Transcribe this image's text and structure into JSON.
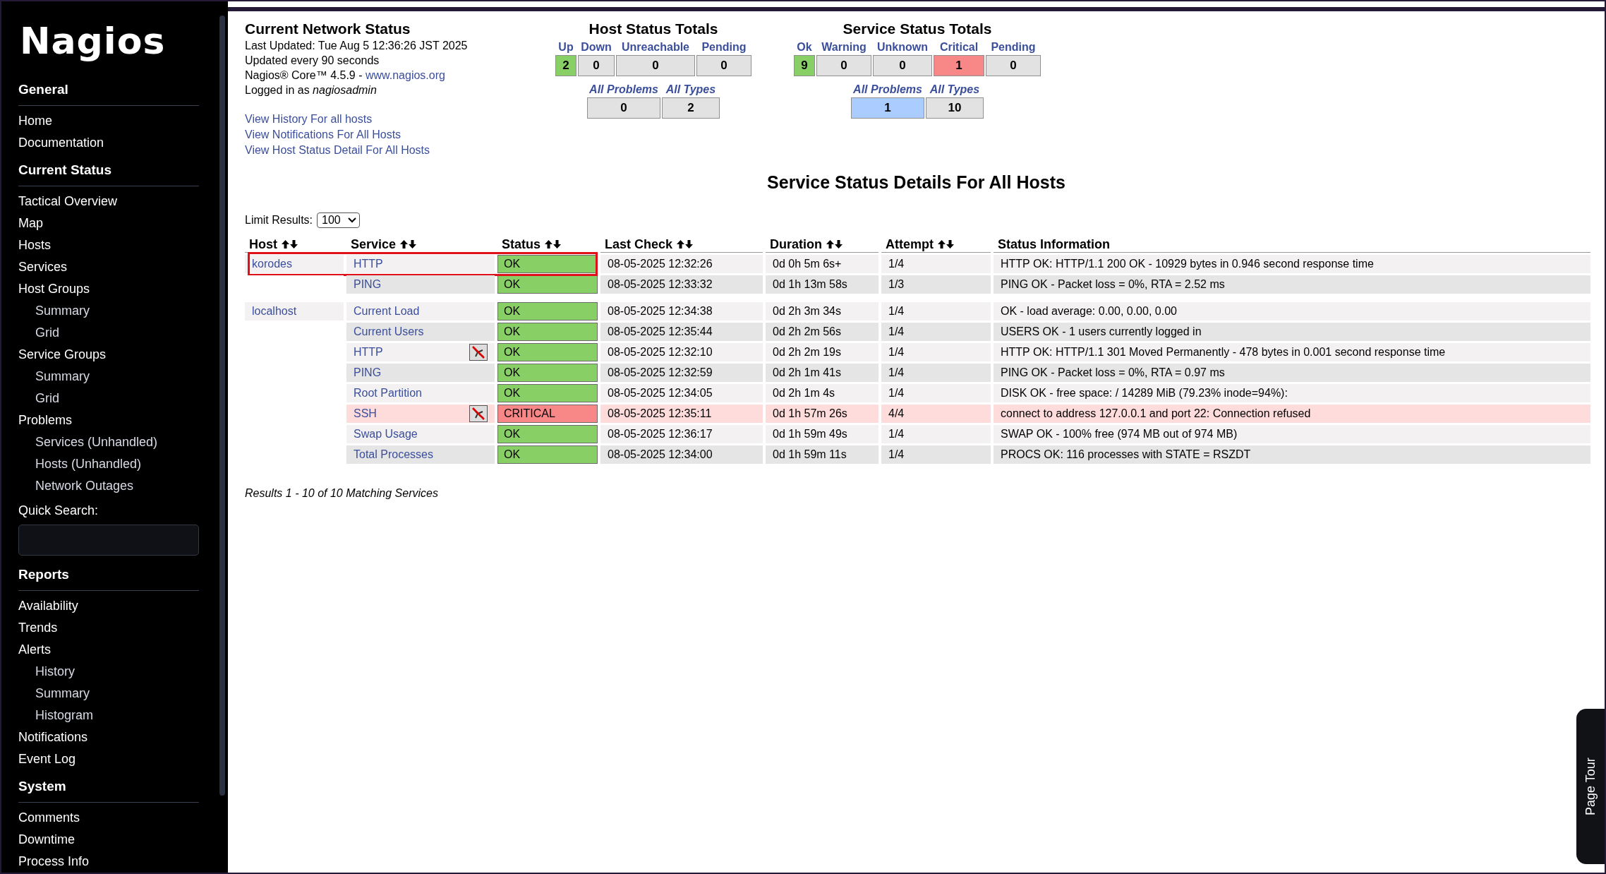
{
  "sidebar": {
    "logo": "Nagios",
    "sections": [
      {
        "title": "General",
        "items": [
          {
            "label": "Home"
          },
          {
            "label": "Documentation"
          }
        ]
      },
      {
        "title": "Current Status",
        "items": [
          {
            "label": "Tactical Overview"
          },
          {
            "label": "Map"
          },
          {
            "label": "Hosts"
          },
          {
            "label": "Services"
          },
          {
            "label": "Host Groups",
            "children": [
              {
                "label": "Summary"
              },
              {
                "label": "Grid"
              }
            ]
          },
          {
            "label": "Service Groups",
            "children": [
              {
                "label": "Summary"
              },
              {
                "label": "Grid"
              }
            ]
          },
          {
            "label": "Problems",
            "children": [
              {
                "label": "Services (Unhandled)"
              },
              {
                "label": "Hosts (Unhandled)"
              },
              {
                "label": "Network Outages"
              }
            ]
          }
        ],
        "search_label": "Quick Search:"
      },
      {
        "title": "Reports",
        "items": [
          {
            "label": "Availability"
          },
          {
            "label": "Trends"
          },
          {
            "label": "Alerts",
            "children": [
              {
                "label": "History"
              },
              {
                "label": "Summary"
              },
              {
                "label": "Histogram"
              }
            ]
          },
          {
            "label": "Notifications"
          },
          {
            "label": "Event Log"
          }
        ]
      },
      {
        "title": "System",
        "items": [
          {
            "label": "Comments"
          },
          {
            "label": "Downtime"
          },
          {
            "label": "Process Info"
          }
        ]
      }
    ]
  },
  "network_status": {
    "title": "Current Network Status",
    "last_updated": "Last Updated: Tue Aug 5 12:36:26 JST 2025",
    "interval": "Updated every 90 seconds",
    "version": "Nagios® Core™ 4.5.9 - ",
    "version_link": "www.nagios.org",
    "logged_in": "Logged in as *nagiosadmin*",
    "links": [
      "View History For all hosts",
      "View Notifications For All Hosts",
      "View Host Status Detail For All Hosts"
    ]
  },
  "host_totals": {
    "title": "Host Status Totals",
    "counts": [
      {
        "label": "Up",
        "value": "2",
        "color": "#88d066"
      },
      {
        "label": "Down",
        "value": "0",
        "color": "#e2e2e2"
      },
      {
        "label": "Unreachable",
        "value": "0",
        "color": "#e2e2e2"
      },
      {
        "label": "Pending",
        "value": "0",
        "color": "#e2e2e2"
      }
    ],
    "summary": [
      {
        "label": "All Problems",
        "value": "0",
        "color": "#e2e2e2"
      },
      {
        "label": "All Types",
        "value": "2",
        "color": "#e2e2e2"
      }
    ]
  },
  "service_totals": {
    "title": "Service Status Totals",
    "counts": [
      {
        "label": "Ok",
        "value": "9",
        "color": "#88d066"
      },
      {
        "label": "Warning",
        "value": "0",
        "color": "#e2e2e2"
      },
      {
        "label": "Unknown",
        "value": "0",
        "color": "#e2e2e2"
      },
      {
        "label": "Critical",
        "value": "1",
        "color": "#f88888"
      },
      {
        "label": "Pending",
        "value": "0",
        "color": "#e2e2e2"
      }
    ],
    "summary": [
      {
        "label": "All Problems",
        "value": "1",
        "color": "#aaccff"
      },
      {
        "label": "All Types",
        "value": "10",
        "color": "#e2e2e2"
      }
    ]
  },
  "page_title": "Service Status Details For All Hosts",
  "limit": {
    "label": "Limit Results:",
    "value": "100"
  },
  "table": {
    "columns": [
      {
        "label": "Host",
        "sortable": true
      },
      {
        "label": "Service",
        "sortable": true
      },
      {
        "label": "Status",
        "sortable": true
      },
      {
        "label": "Last Check",
        "sortable": true
      },
      {
        "label": "Duration",
        "sortable": true
      },
      {
        "label": "Attempt",
        "sortable": true
      },
      {
        "label": "Status Information",
        "sortable": false
      }
    ],
    "hosts": [
      {
        "name": "korodes",
        "highlighted": true,
        "services": [
          {
            "name": "HTTP",
            "notifications_disabled": false,
            "status": "OK",
            "color": "#88d066",
            "critical": false,
            "last_check": "08-05-2025 12:32:26",
            "duration": "0d 0h 5m 6s+",
            "attempt": "1/4",
            "info": "HTTP OK: HTTP/1.1 200 OK - 10929 bytes in 0.946 second response time"
          },
          {
            "name": "PING",
            "notifications_disabled": false,
            "status": "OK",
            "color": "#88d066",
            "critical": false,
            "last_check": "08-05-2025 12:33:32",
            "duration": "0d 1h 13m 58s",
            "attempt": "1/3",
            "info": "PING OK - Packet loss = 0%, RTA = 2.52 ms"
          }
        ]
      },
      {
        "name": "localhost",
        "highlighted": false,
        "services": [
          {
            "name": "Current Load",
            "notifications_disabled": false,
            "status": "OK",
            "color": "#88d066",
            "critical": false,
            "last_check": "08-05-2025 12:34:38",
            "duration": "0d 2h 3m 34s",
            "attempt": "1/4",
            "info": "OK - load average: 0.00, 0.00, 0.00"
          },
          {
            "name": "Current Users",
            "notifications_disabled": false,
            "status": "OK",
            "color": "#88d066",
            "critical": false,
            "last_check": "08-05-2025 12:35:44",
            "duration": "0d 2h 2m 56s",
            "attempt": "1/4",
            "info": "USERS OK - 1 users currently logged in"
          },
          {
            "name": "HTTP",
            "notifications_disabled": true,
            "status": "OK",
            "color": "#88d066",
            "critical": false,
            "last_check": "08-05-2025 12:32:10",
            "duration": "0d 2h 2m 19s",
            "attempt": "1/4",
            "info": "HTTP OK: HTTP/1.1 301 Moved Permanently - 478 bytes in 0.001 second response time"
          },
          {
            "name": "PING",
            "notifications_disabled": false,
            "status": "OK",
            "color": "#88d066",
            "critical": false,
            "last_check": "08-05-2025 12:32:59",
            "duration": "0d 2h 1m 41s",
            "attempt": "1/4",
            "info": "PING OK - Packet loss = 0%, RTA = 0.97 ms"
          },
          {
            "name": "Root Partition",
            "notifications_disabled": false,
            "status": "OK",
            "color": "#88d066",
            "critical": false,
            "last_check": "08-05-2025 12:34:05",
            "duration": "0d 2h 1m 4s",
            "attempt": "1/4",
            "info": "DISK OK - free space: / 14289 MiB (79.23% inode=94%):"
          },
          {
            "name": "SSH",
            "notifications_disabled": true,
            "status": "CRITICAL",
            "color": "#f88888",
            "critical": true,
            "last_check": "08-05-2025 12:35:11",
            "duration": "0d 1h 57m 26s",
            "attempt": "4/4",
            "info": "connect to address 127.0.0.1 and port 22: Connection refused"
          },
          {
            "name": "Swap Usage",
            "notifications_disabled": false,
            "status": "OK",
            "color": "#88d066",
            "critical": false,
            "last_check": "08-05-2025 12:36:17",
            "duration": "0d 1h 59m 49s",
            "attempt": "1/4",
            "info": "SWAP OK - 100% free (974 MB out of 974 MB)"
          },
          {
            "name": "Total Processes",
            "notifications_disabled": false,
            "status": "OK",
            "color": "#88d066",
            "critical": false,
            "last_check": "08-05-2025 12:34:00",
            "duration": "0d 1h 59m 11s",
            "attempt": "1/4",
            "info": "PROCS OK: 116 processes with STATE = RSZDT"
          }
        ]
      }
    ]
  },
  "results": "Results 1 - 10 of 10 Matching Services",
  "page_tour": "Page Tour"
}
